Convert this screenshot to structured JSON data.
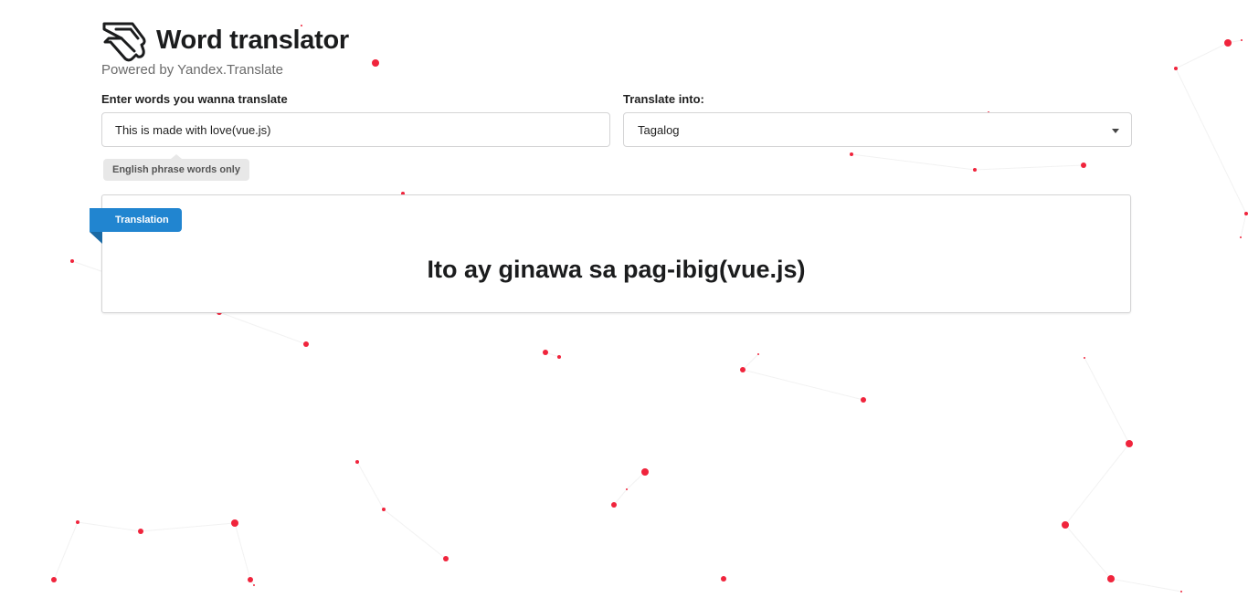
{
  "header": {
    "title": "Word translator",
    "subtitle": "Powered by Yandex.Translate",
    "logo_icon": "hand-pointer-icon"
  },
  "input": {
    "label": "Enter words you wanna translate",
    "value": "This is made with love(vue.js)",
    "hint": "English phrase words only"
  },
  "language_select": {
    "label": "Translate into:",
    "selected": "Tagalog"
  },
  "result": {
    "ribbon": "Translation",
    "text": "Ito ay ginawa sa pag-ibig(vue.js)"
  },
  "colors": {
    "accent": "#2185d0",
    "particle": "#f0243c",
    "particle_line": "#f2f2f2"
  }
}
